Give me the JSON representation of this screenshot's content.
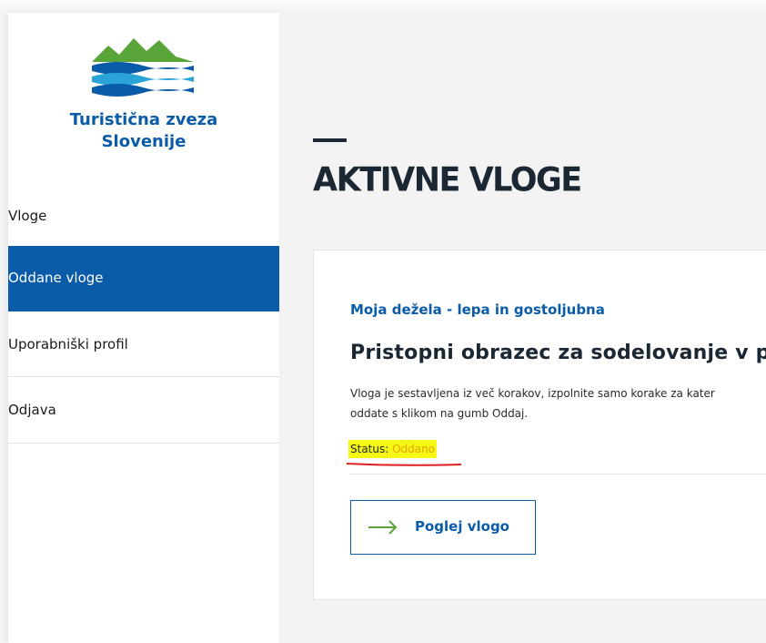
{
  "brand": {
    "name_line1": "Turistična zveza",
    "name_line2": "Slovenije",
    "color": "#0a5ba8",
    "logo_icon": "mountains-waves-logo"
  },
  "sidebar": {
    "items": [
      {
        "label": "Vloge",
        "active": false
      },
      {
        "label": "Oddane vloge",
        "active": true
      },
      {
        "label": "Uporabniški profil",
        "active": false
      },
      {
        "label": "Odjava",
        "active": false
      }
    ]
  },
  "main": {
    "title": "AKTIVNE VLOGE",
    "card": {
      "subtitle": "Moja dežela - lepa in gostoljubna",
      "title": "Pristopni obrazec za sodelovanje v pr",
      "description_line1": "Vloga je sestavljena iz več korakov, izpolnite samo korake za kater",
      "description_line2": "oddate s klikom na gumb Oddaj.",
      "status_label": "Status: ",
      "status_value": "Oddano",
      "status_color": "#e8a300",
      "highlight_color": "#f7f714",
      "button_label": "Poglej vlogo",
      "button_icon": "arrow-right-icon"
    }
  }
}
